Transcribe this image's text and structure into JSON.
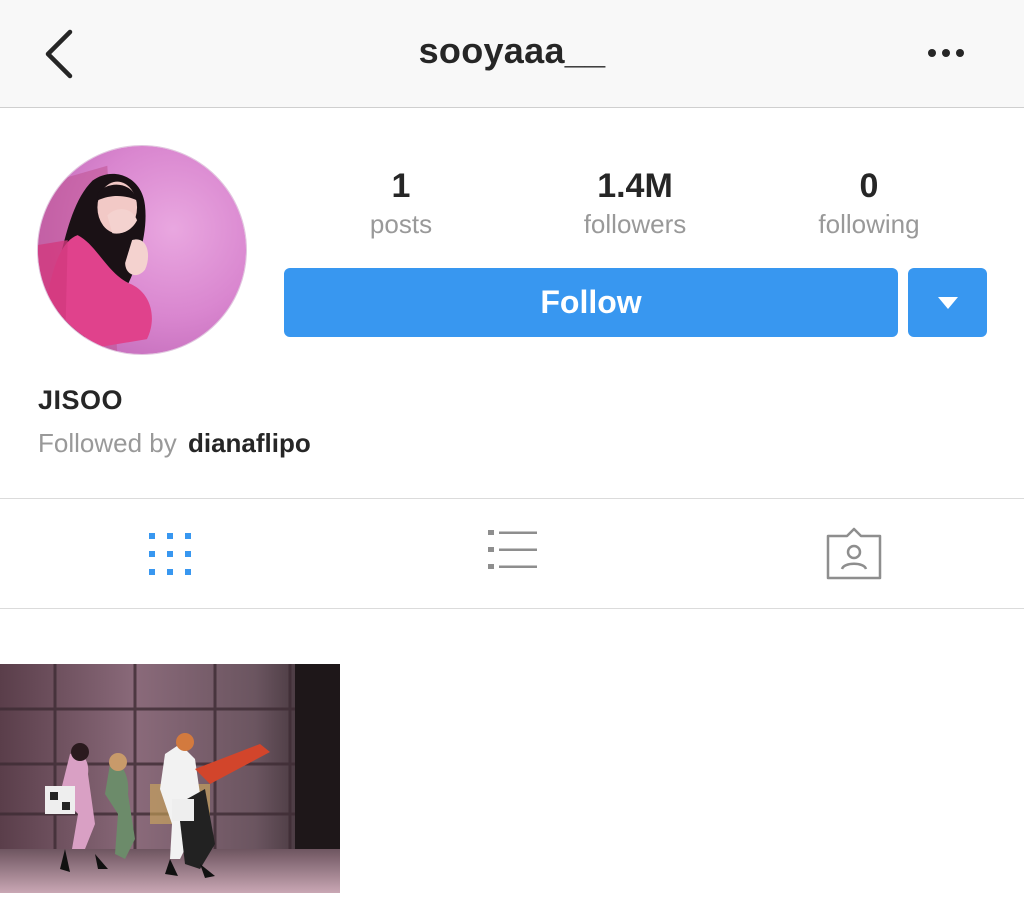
{
  "header": {
    "username": "sooyaaa__",
    "back_icon": "chevron-left-icon",
    "more_icon": "ellipsis-icon"
  },
  "profile": {
    "display_name": "JISOO",
    "stats": [
      {
        "value": "1",
        "label": "posts"
      },
      {
        "value": "1.4M",
        "label": "followers"
      },
      {
        "value": "0",
        "label": "following"
      }
    ],
    "follow_label": "Follow",
    "followed_by_prefix": "Followed by",
    "followed_by_user": "dianaflipo"
  },
  "tabs": [
    {
      "icon": "grid-icon",
      "active": true
    },
    {
      "icon": "list-icon",
      "active": false
    },
    {
      "icon": "tagged-icon",
      "active": false
    }
  ],
  "colors": {
    "accent": "#3897f0",
    "text": "#262626",
    "muted": "#999999",
    "header_bg": "#f8f8f8"
  }
}
